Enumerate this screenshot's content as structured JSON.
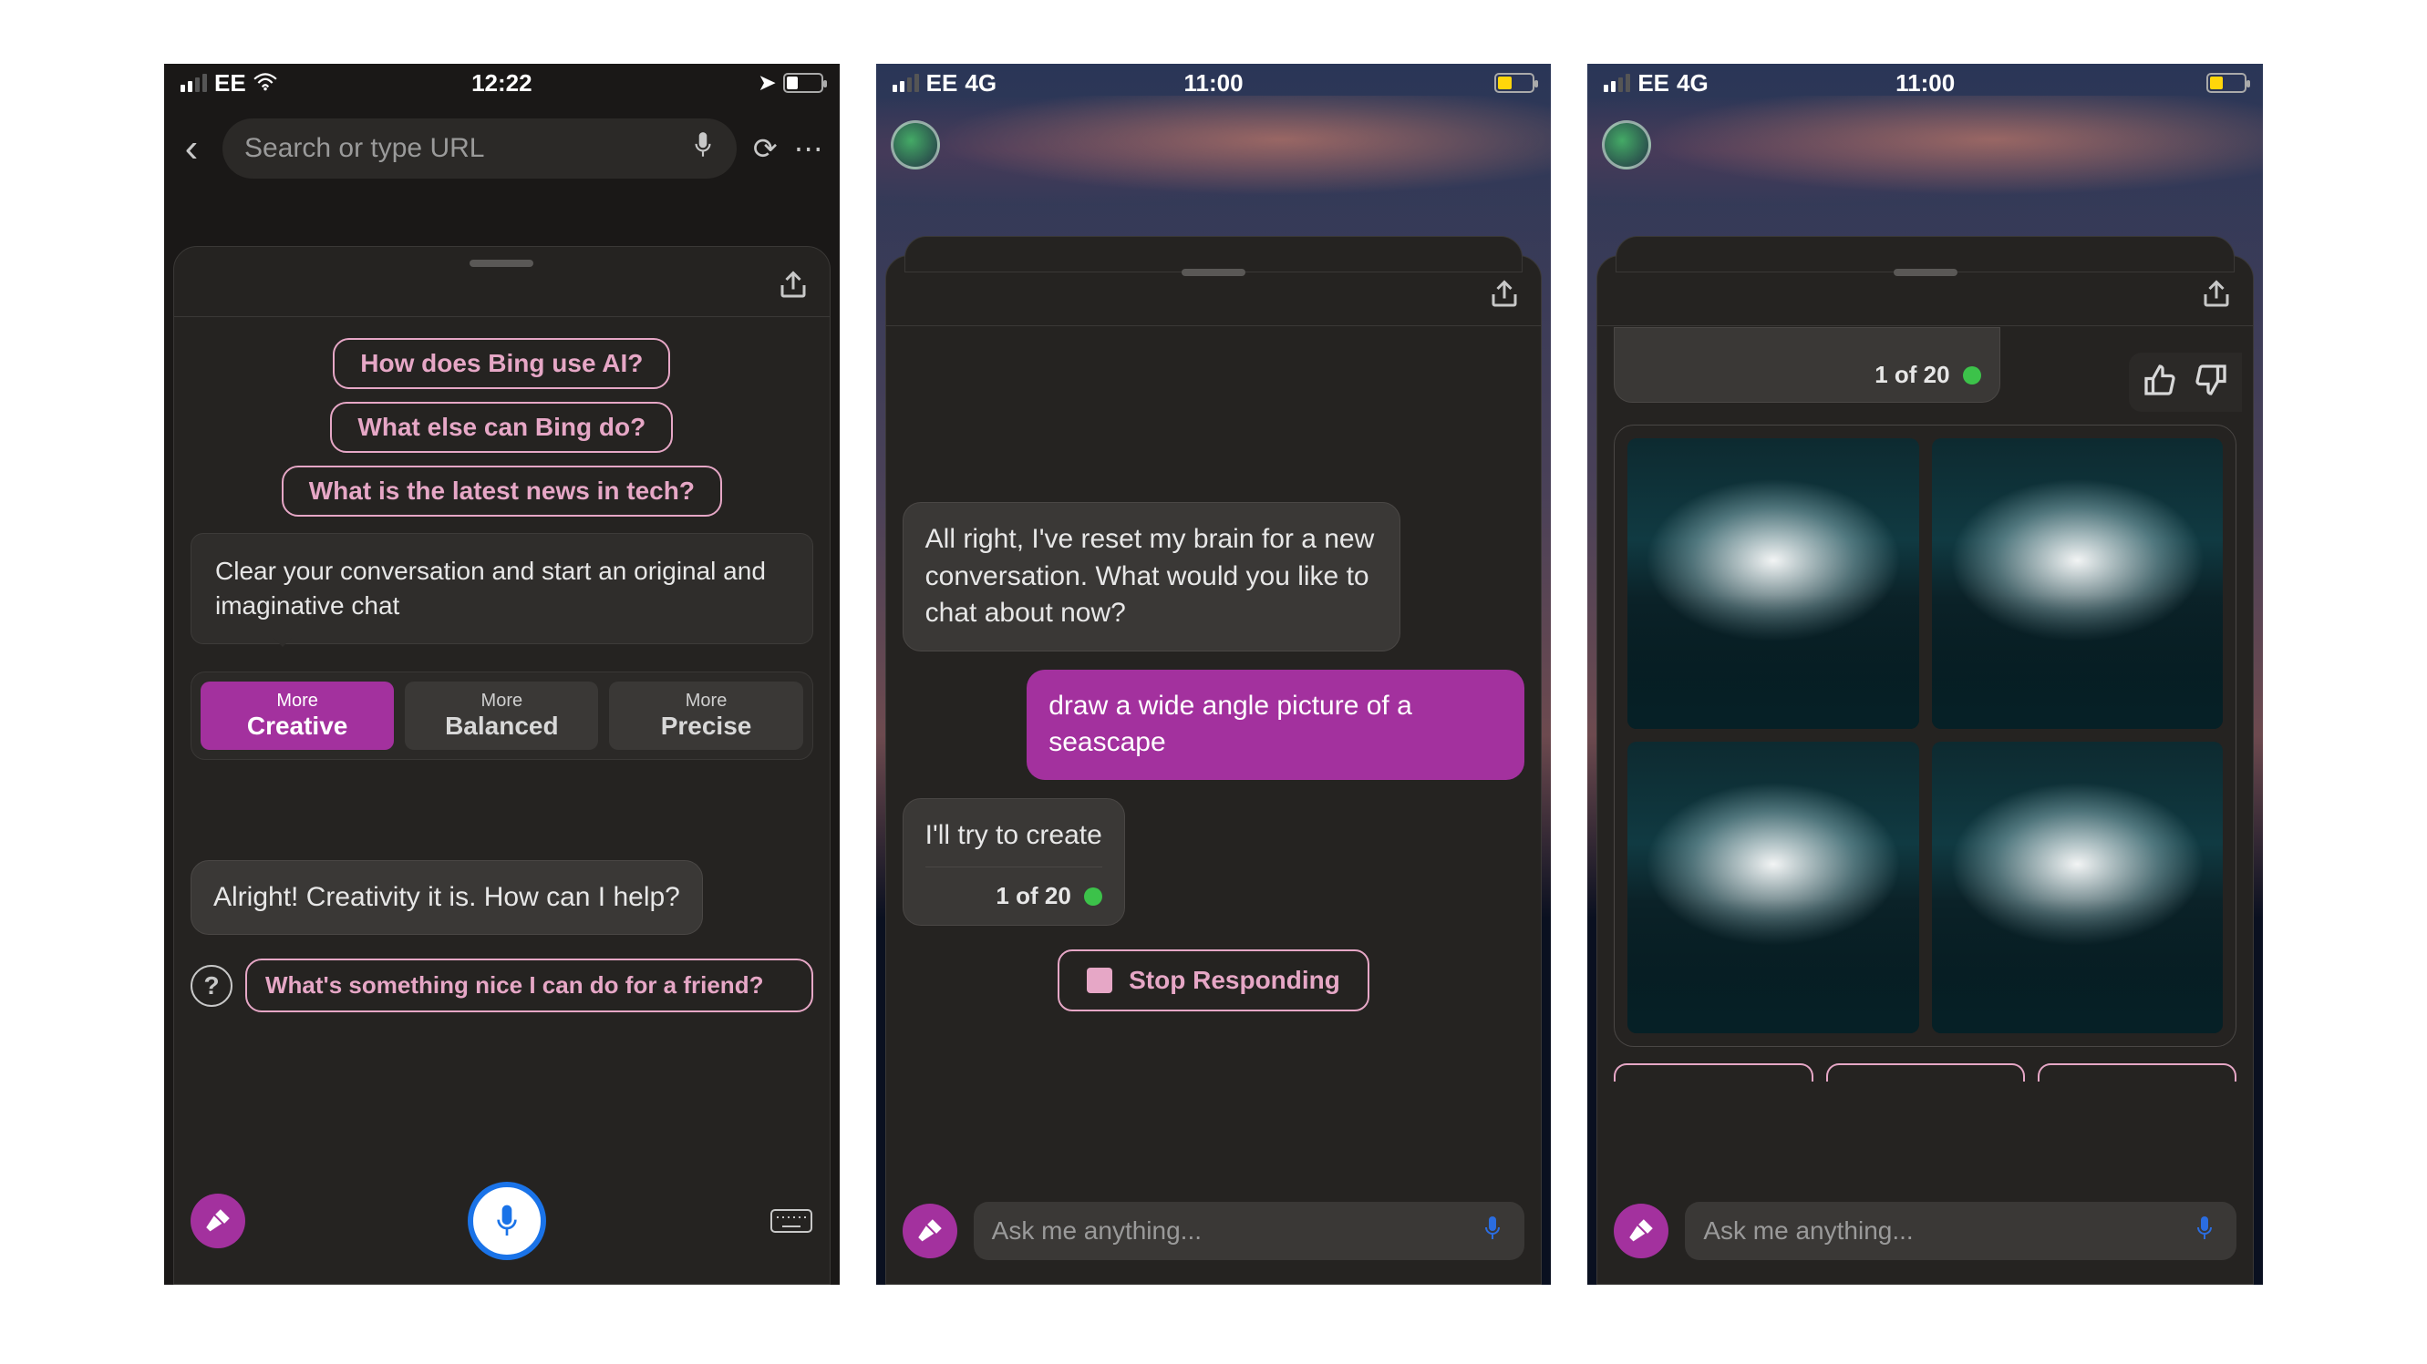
{
  "phone1": {
    "status": {
      "carrier": "EE",
      "time": "12:22"
    },
    "urlbar": {
      "placeholder": "Search or type URL"
    },
    "suggestions": {
      "s1": "How does Bing use AI?",
      "s2": "What else can Bing do?",
      "s3": "What is the latest news in tech?"
    },
    "tooltip": "Clear your conversation and start an original and imaginative chat",
    "modes": {
      "more": "More",
      "creative": "Creative",
      "balanced": "Balanced",
      "precise": "Precise"
    },
    "assistant_msg": "Alright! Creativity it is. How can I help?",
    "bottom_suggestion": "What's something nice I can do for a friend?"
  },
  "phone2": {
    "status": {
      "carrier": "EE",
      "network": "4G",
      "time": "11:00"
    },
    "assistant_reset": "All right, I've reset my brain for a new conversation. What would you like to chat about now?",
    "user_prompt": "draw a wide angle picture of a seascape",
    "assistant_partial": "I'll try to create",
    "progress": "1 of 20",
    "stop": "Stop Responding",
    "composer": {
      "placeholder": "Ask me anything..."
    }
  },
  "phone3": {
    "status": {
      "carrier": "EE",
      "network": "4G",
      "time": "11:00"
    },
    "progress": "1 of 20",
    "composer": {
      "placeholder": "Ask me anything..."
    }
  },
  "colors": {
    "accent": "#a3319e",
    "chip_border": "#e6a7c6",
    "status_green": "#3cc24a"
  }
}
